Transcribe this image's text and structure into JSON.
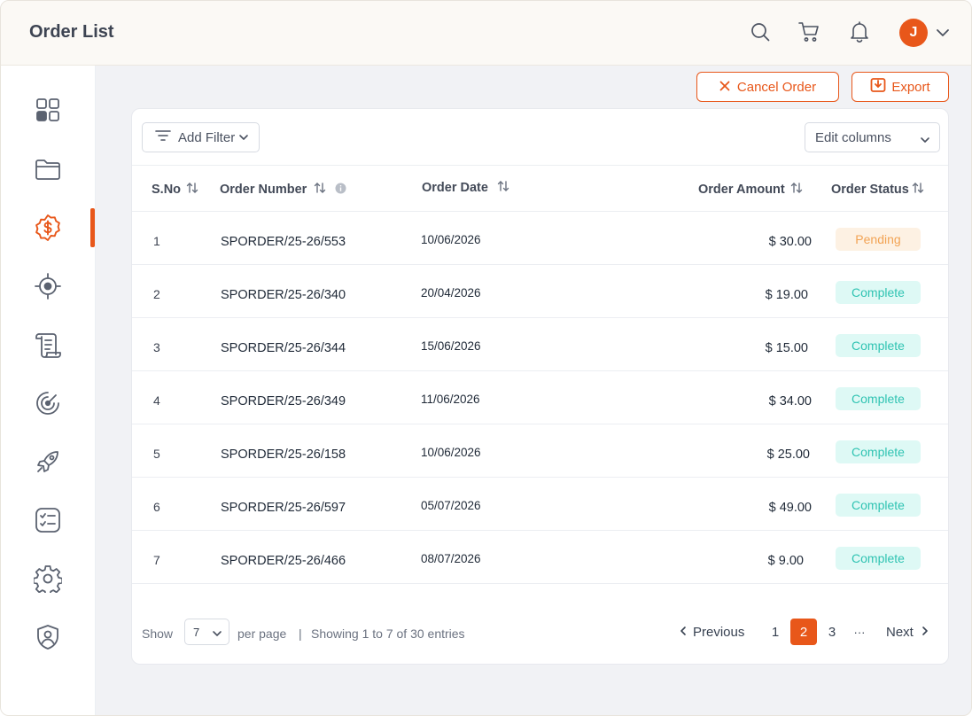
{
  "header": {
    "title": "Order List",
    "avatar_initial": "J"
  },
  "actions": {
    "cancel_label": "Cancel Order",
    "export_label": "Export"
  },
  "toolbar": {
    "filter_label": "Add Filter",
    "edit_columns_label": "Edit columns"
  },
  "table": {
    "columns": [
      "S.No",
      "Order Number",
      "Order Date",
      "Order Amount",
      "Order Status"
    ],
    "rows": [
      {
        "sno": "1",
        "number": "SPORDER/25-26/553",
        "date": "10/06/2026",
        "amount": "$ 30.00",
        "status": "Pending"
      },
      {
        "sno": "2",
        "number": "SPORDER/25-26/340",
        "date": "20/04/2026",
        "amount": "$ 19.00",
        "status": "Complete"
      },
      {
        "sno": "3",
        "number": "SPORDER/25-26/344",
        "date": "15/06/2026",
        "amount": "$ 15.00",
        "status": "Complete"
      },
      {
        "sno": "4",
        "number": "SPORDER/25-26/349",
        "date": "11/06/2026",
        "amount": "$ 34.00",
        "status": "Complete"
      },
      {
        "sno": "5",
        "number": "SPORDER/25-26/158",
        "date": "10/06/2026",
        "amount": "$ 25.00",
        "status": "Complete"
      },
      {
        "sno": "6",
        "number": "SPORDER/25-26/597",
        "date": "05/07/2026",
        "amount": "$ 49.00",
        "status": "Complete"
      },
      {
        "sno": "7",
        "number": "SPORDER/25-26/466",
        "date": "08/07/2026",
        "amount": "$ 9.00",
        "status": "Complete"
      }
    ]
  },
  "pagination": {
    "show_label": "Show",
    "per_page_value": "7",
    "per_page_label": "per page",
    "separator": "|",
    "entries_text": "Showing 1 to 7 of 30 entries",
    "previous_label": "Previous",
    "pages": [
      "1",
      "2",
      "3"
    ],
    "current_page": "2",
    "ellipsis": "···",
    "next_label": "Next"
  },
  "colors": {
    "accent": "#e8571a",
    "pending_bg": "#fdf1e3",
    "pending_text": "#f2a354",
    "complete_bg": "#def9f5",
    "complete_text": "#2fc3b2"
  },
  "sidebar_icons": [
    "dashboard-icon",
    "folder-icon",
    "dollar-badge-icon",
    "target-icon",
    "scroll-icon",
    "radar-icon",
    "rocket-icon",
    "checklist-icon",
    "gear-icon",
    "shield-user-icon"
  ],
  "active_sidebar_item": "dollar-badge-icon"
}
